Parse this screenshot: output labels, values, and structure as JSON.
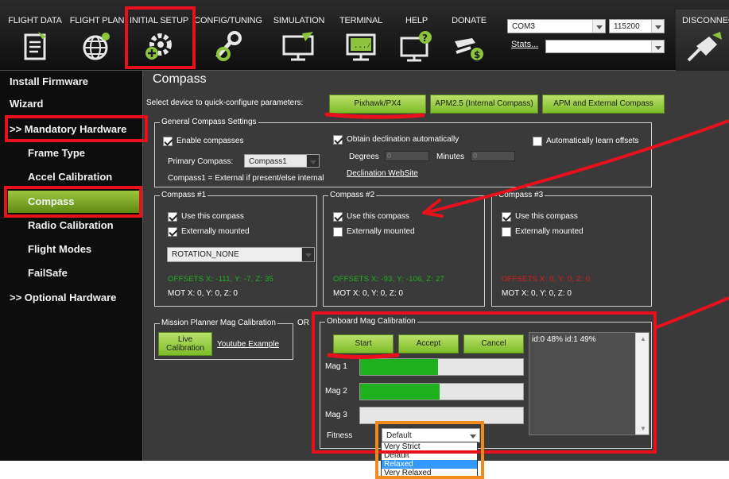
{
  "nav": [
    {
      "label": "FLIGHT DATA",
      "icon": "flight-data-icon"
    },
    {
      "label": "FLIGHT PLAN",
      "icon": "flight-plan-icon"
    },
    {
      "label": "INITIAL SETUP",
      "icon": "initial-setup-icon"
    },
    {
      "label": "CONFIG/TUNING",
      "icon": "config-tuning-icon"
    },
    {
      "label": "SIMULATION",
      "icon": "simulation-icon"
    },
    {
      "label": "TERMINAL",
      "icon": "terminal-icon"
    },
    {
      "label": "HELP",
      "icon": "help-icon"
    },
    {
      "label": "DONATE",
      "icon": "donate-icon"
    }
  ],
  "connection": {
    "port": "COM3",
    "baud": "115200",
    "stats_label": "Stats...",
    "disconnect_label": "DISCONNEC"
  },
  "sidebar": {
    "items": [
      {
        "label": "Install Firmware"
      },
      {
        "label": "Wizard"
      },
      {
        "label": ">> Mandatory Hardware"
      },
      {
        "label": "Frame Type"
      },
      {
        "label": "Accel Calibration"
      },
      {
        "label": "Compass"
      },
      {
        "label": "Radio Calibration"
      },
      {
        "label": "Flight Modes"
      },
      {
        "label": "FailSafe"
      },
      {
        "label": ">> Optional Hardware"
      }
    ]
  },
  "compass": {
    "title": "Compass",
    "quick_label": "Select device to quick-configure parameters:",
    "presets": [
      "Pixhawk/PX4",
      "APM2.5 (Internal Compass)",
      "APM and External Compass"
    ],
    "general": {
      "title": "General Compass Settings",
      "enable_label": "Enable compasses",
      "obtain_decl_label": "Obtain declination automatically",
      "auto_learn_label": "Automatically learn offsets",
      "degrees_label": "Degrees",
      "degrees_value": "0",
      "minutes_label": "Minutes",
      "minutes_value": "0",
      "primary_label": "Primary Compass:",
      "primary_value": "Compass1",
      "note": "Compass1 = External if present/else internal",
      "decl_link": "Declination WebSite"
    },
    "compasses": [
      {
        "title": "Compass #1",
        "use_label": "Use this compass",
        "ext_label": "Externally mounted",
        "use": true,
        "external": true,
        "rotation": "ROTATION_NONE",
        "offsets": "OFFSETS  X: -111,   Y: -7,   Z: 35",
        "offsets_color": "#1fb21f",
        "mot": "MOT         X: 0,   Y: 0,   Z: 0"
      },
      {
        "title": "Compass #2",
        "use_label": "Use this compass",
        "ext_label": "Externally mounted",
        "use": true,
        "external": false,
        "offsets": "OFFSETS  X: -93,   Y: -106,   Z: 27",
        "offsets_color": "#1fb21f",
        "mot": "MOT         X: 0,   Y: 0,   Z: 0"
      },
      {
        "title": "Compass #3",
        "use_label": "Use this compass",
        "ext_label": "Externally mounted",
        "use": true,
        "external": false,
        "offsets": "OFFSETS  X: 0,   Y: 0,   Z: 0",
        "offsets_color": "#e01c1c",
        "mot": "MOT         X: 0,   Y: 0,   Z: 0"
      }
    ],
    "mp_cal": {
      "title": "Mission Planner Mag Calibration",
      "or_label": "OR",
      "live_label_1": "Live",
      "live_label_2": "Calibration",
      "youtube_link": "Youtube Example"
    },
    "onboard": {
      "title": "Onboard Mag Calibration",
      "start_label": "Start",
      "accept_label": "Accept",
      "cancel_label": "Cancel",
      "mag_labels": [
        "Mag 1",
        "Mag 2",
        "Mag 3"
      ],
      "mag_progress": [
        0.48,
        0.49,
        0
      ],
      "log_text": "id:0 48% id:1  49%",
      "fitness_label": "Fitness",
      "fitness_value": "Default",
      "fitness_options": [
        "Very Strict",
        "Default",
        "Relaxed",
        "Very Relaxed"
      ],
      "fitness_highlighted": "Relaxed"
    }
  },
  "colors": {
    "highlight_red": "#e8101c",
    "highlight_orange": "#f08a1c",
    "active_green": "#8dbb2e",
    "progress_green": "#1eb01e"
  }
}
